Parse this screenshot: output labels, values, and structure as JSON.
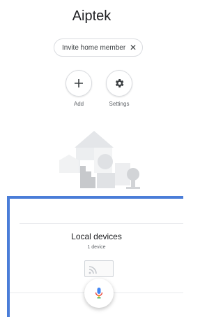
{
  "home": {
    "title": "Aiptek"
  },
  "invite_chip": {
    "label": "Invite home member",
    "close_icon": "close-icon"
  },
  "actions": [
    {
      "label": "Add",
      "icon": "plus-icon"
    },
    {
      "label": "Settings",
      "icon": "gear-icon"
    }
  ],
  "local_devices": {
    "title": "Local devices",
    "count": "1 device",
    "device_icon": "cast-icon"
  },
  "fab": {
    "icon": "microphone-icon"
  },
  "colors": {
    "accent_border": "#4a7dd8",
    "mic_blue": "#4285f4",
    "mic_red": "#ea4335",
    "mic_yellow": "#fbbc04",
    "mic_green": "#34a853"
  }
}
